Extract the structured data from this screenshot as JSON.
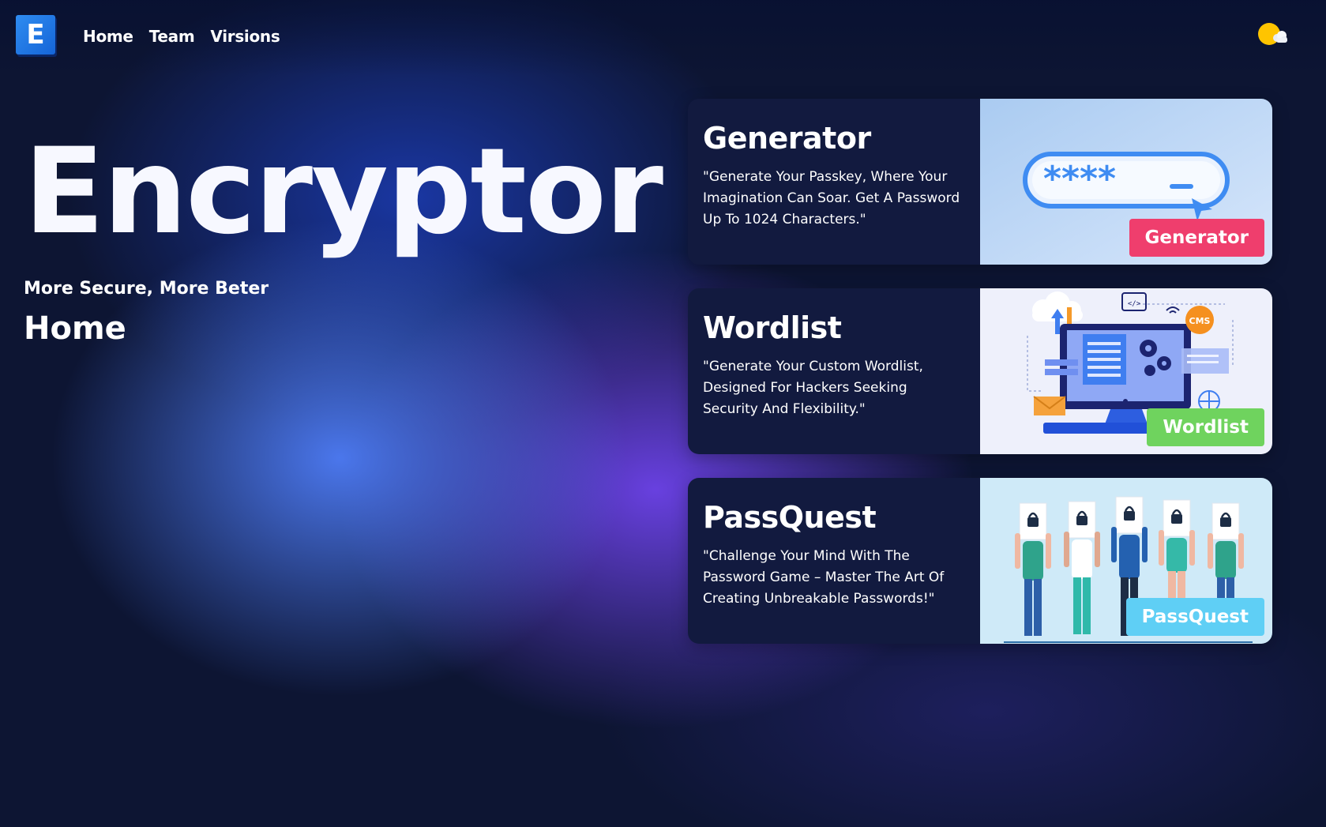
{
  "nav": {
    "logo_letter": "E",
    "links": [
      "Home",
      "Team",
      "Virsions"
    ]
  },
  "hero": {
    "title": "Encryptor",
    "subtitle": "More Secure, More Beter",
    "page": "Home"
  },
  "cards": [
    {
      "title": "Generator",
      "description": "\"Generate Your Passkey, Where Your Imagination Can Soar. Get A Password Up To 1024 Characters.\"",
      "button": "Generator",
      "button_color": "#ef3e6d",
      "image_icon": "password-field-illustration"
    },
    {
      "title": "Wordlist",
      "description": "\"Generate Your Custom Wordlist, Designed For Hackers Seeking Security And Flexibility.\"",
      "button": "Wordlist",
      "button_color": "#6fd35e",
      "image_icon": "computer-network-illustration",
      "image_badge": "CMS",
      "image_code": "</>"
    },
    {
      "title": "PassQuest",
      "description": "\"Challenge Your Mind With The Password Game – Master The Art Of Creating Unbreakable Passwords!\"",
      "button": "PassQuest",
      "button_color": "#5fcff5",
      "image_icon": "people-holding-locks-illustration"
    }
  ],
  "colors": {
    "background": "#0d1533",
    "card_bg": "#121a3f",
    "logo": "#1e7be6",
    "theme_toggle": "#ffc400"
  },
  "icons": {
    "theme_toggle": "sun-cloud-icon"
  }
}
